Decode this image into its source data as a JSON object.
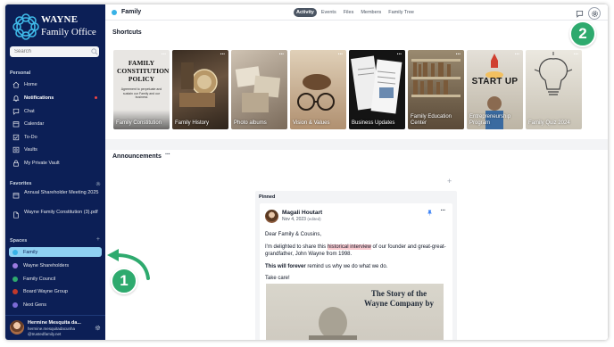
{
  "brand": {
    "line1": "WAYNE",
    "line2": "Family Office"
  },
  "search": {
    "placeholder": "Search"
  },
  "sidebar": {
    "personal_label": "Personal",
    "personal_items": [
      {
        "label": "Home",
        "icon": "home-icon"
      },
      {
        "label": "Notifications",
        "icon": "bell-icon",
        "unread": true
      },
      {
        "label": "Chat",
        "icon": "chat-icon"
      },
      {
        "label": "Calendar",
        "icon": "calendar-icon"
      },
      {
        "label": "To-Do",
        "icon": "checkbox-icon"
      },
      {
        "label": "Vaults",
        "icon": "vault-icon"
      },
      {
        "label": "My Private Vault",
        "icon": "lock-icon"
      }
    ],
    "favorites_label": "Favorites",
    "favorites": [
      {
        "label": "Annual Shareholder Meeting 2025",
        "icon": "calendar-icon"
      },
      {
        "label": "Wayne Family Constitution (3).pdf",
        "icon": "file-icon"
      }
    ],
    "spaces_label": "Spaces",
    "spaces": [
      {
        "label": "Family",
        "color": "#38b2e6",
        "active": true
      },
      {
        "label": "Wayne Shareholders",
        "color": "#9b7be0"
      },
      {
        "label": "Family Council",
        "color": "#2eaa6e"
      },
      {
        "label": "Board Wayne Group",
        "color": "#c0392b"
      },
      {
        "label": "Next Gens",
        "color": "#7c6bd6"
      }
    ]
  },
  "user": {
    "name": "Hermine Mesquita da...",
    "email": "hermine.mesquitadacunha @trustedfamily.net"
  },
  "header": {
    "title": "Family",
    "tabs": [
      {
        "label": "Activity",
        "active": true
      },
      {
        "label": "Events"
      },
      {
        "label": "Files"
      },
      {
        "label": "Members"
      },
      {
        "label": "Family Tree"
      }
    ]
  },
  "shortcuts": {
    "title": "Shortcuts",
    "items": [
      {
        "label": "Family Constitution",
        "art_text": "FAMILY CONSTITUTION POLICY",
        "art_sub": "Agreement to perpetuate and sustain our Family and our business",
        "bg": "#e8e6e3"
      },
      {
        "label": "Family History",
        "bg": "#4a3a2a"
      },
      {
        "label": "Photo albums",
        "bg": "#a09080"
      },
      {
        "label": "Vision & Values",
        "bg": "#c8b8a0"
      },
      {
        "label": "Business Updates",
        "bg": "#1a1a1a"
      },
      {
        "label": "Family Education Center",
        "bg": "#8a7a60"
      },
      {
        "label": "Entrepreneurship Program",
        "art_text": "START UP",
        "bg": "#d8d4cc"
      },
      {
        "label": "Family Quiz 2024",
        "bg": "#e0ddd5"
      }
    ]
  },
  "announcements": {
    "title": "Announcements",
    "pinned_label": "Pinned",
    "post": {
      "author": "Magali Houtart",
      "date": "Nov 4, 2023",
      "edited": "(edited)",
      "greeting": "Dear Family & Cousins,",
      "line_before": "I'm delighted to share this ",
      "highlight": "historical interview",
      "line_after": " of our founder and great-great-grandfather, John Wayne from 1998.",
      "bold_part": "This will forever",
      "rest_part": " remind us why we do what we do.",
      "signoff": "Take care!",
      "image_title": "The Story of the Wayne Company by"
    }
  },
  "callouts": {
    "one": "1",
    "two": "2"
  },
  "colors": {
    "sidebar": "#0c1f56",
    "accent": "#38b2e6",
    "callout": "#2eaa6e"
  }
}
